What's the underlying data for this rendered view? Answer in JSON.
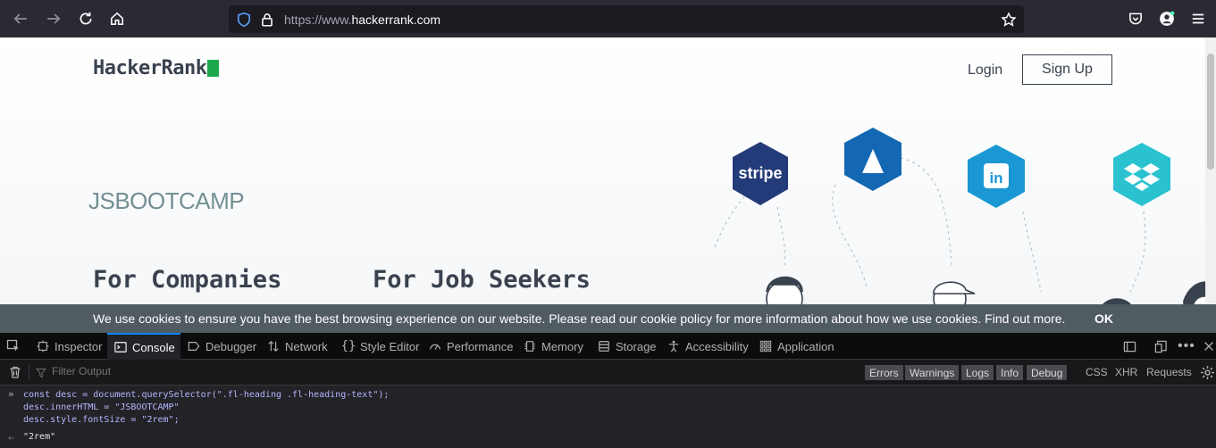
{
  "browser": {
    "url_prefix": "https://www.",
    "url_domain": "hackerrank.com"
  },
  "site": {
    "logo_text": "HackerRank",
    "login_label": "Login",
    "signup_label": "Sign Up",
    "hero_title": "JSBOOTCAMP",
    "headings": [
      "For Companies",
      "For Job Seekers"
    ],
    "company_logos": [
      "stripe"
    ]
  },
  "cookie_banner": {
    "text": "We use cookies to ensure you have the best browsing experience on our website. Please read our cookie policy for more information about how we use cookies. Find out more.",
    "ok_label": "OK"
  },
  "devtools": {
    "tabs": [
      "Inspector",
      "Console",
      "Debugger",
      "Network",
      "Style Editor",
      "Performance",
      "Memory",
      "Storage",
      "Accessibility",
      "Application"
    ],
    "active_tab": "Console",
    "filter_placeholder": "Filter Output",
    "levels": [
      "Errors",
      "Warnings",
      "Logs",
      "Info",
      "Debug"
    ],
    "categories": [
      "CSS",
      "XHR",
      "Requests"
    ],
    "input_lines": [
      "const desc = document.querySelector(\".fl-heading .fl-heading-text\");",
      "desc.innerHTML = \"JSBOOTCAMP\"",
      "desc.style.fontSize = \"2rem\";"
    ],
    "result": "\"2rem\"",
    "accent": "#0a84ff"
  }
}
